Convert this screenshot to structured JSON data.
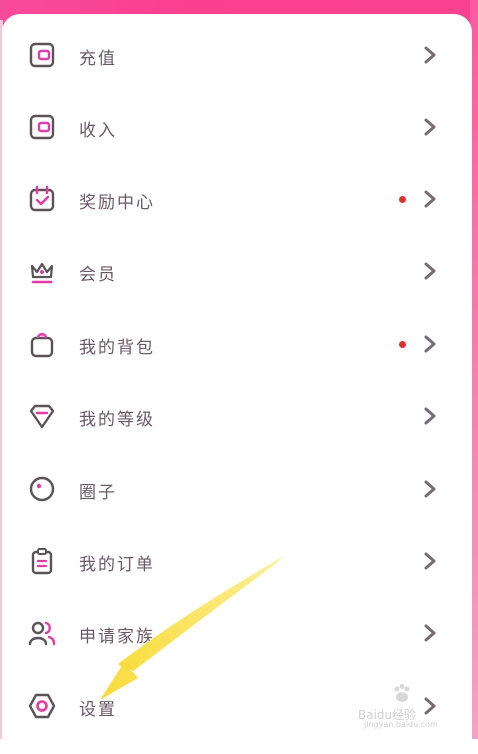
{
  "colors": {
    "accent": "#e23aa6",
    "icon_gray": "#5b5358",
    "dot": "#e0322c",
    "arrow": "#fbe35a"
  },
  "menu": [
    {
      "label": "充值",
      "icon": "wallet-icon",
      "dot": false
    },
    {
      "label": "收入",
      "icon": "wallet-icon",
      "dot": false
    },
    {
      "label": "奖励中心",
      "icon": "calendar-check-icon",
      "dot": true
    },
    {
      "label": "会员",
      "icon": "crown-icon",
      "dot": false
    },
    {
      "label": "我的背包",
      "icon": "bag-icon",
      "dot": true
    },
    {
      "label": "我的等级",
      "icon": "diamond-icon",
      "dot": false
    },
    {
      "label": "圈子",
      "icon": "circle-icon",
      "dot": false
    },
    {
      "label": "我的订单",
      "icon": "order-icon",
      "dot": false
    },
    {
      "label": "申请家族",
      "icon": "users-icon",
      "dot": false
    },
    {
      "label": "设置",
      "icon": "hexagon-settings-icon",
      "dot": false
    }
  ],
  "watermark": {
    "brand": "Baidu经验",
    "domain": "jingyan.baidu.com"
  }
}
